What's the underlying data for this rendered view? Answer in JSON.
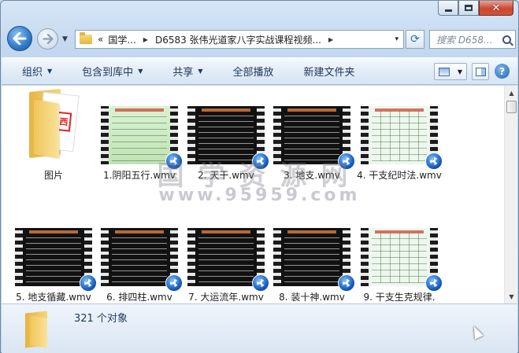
{
  "window": {
    "caption": {
      "minimize": "minimize",
      "maximize": "maximize",
      "close": "close"
    }
  },
  "nav": {
    "address": {
      "overflow": "«",
      "crumbs": [
        "国学...",
        "D6583 张伟光道家八字实战课程视频..."
      ],
      "dropdown": "▾"
    },
    "search_placeholder": "搜索 D658..."
  },
  "toolbar": {
    "organize": "组织",
    "include_library": "包含到库中",
    "share": "共享",
    "play_all": "全部播放",
    "new_folder": "新建文件夹"
  },
  "watermark": {
    "line1": "国学资源网",
    "line2": "www.95959.com"
  },
  "items": [
    {
      "label": "图片",
      "kind": "folder"
    },
    {
      "label": "1.阴阳五行.wmv",
      "kind": "video",
      "style": "green"
    },
    {
      "label": "2. 天干.wmv",
      "kind": "video",
      "style": "dark"
    },
    {
      "label": "3. 地支.wmv",
      "kind": "video",
      "style": "dark"
    },
    {
      "label": "4. 干支纪时法.wmv",
      "kind": "video",
      "style": "light"
    },
    {
      "label": "5. 地支循藏.wmv",
      "kind": "video",
      "style": "dark"
    },
    {
      "label": "6. 排四柱.wmv",
      "kind": "video",
      "style": "dark"
    },
    {
      "label": "7. 大运流年.wmv",
      "kind": "video",
      "style": "dark"
    },
    {
      "label": "8. 装十神.wmv",
      "kind": "video",
      "style": "dark"
    },
    {
      "label": "9. 干支生克规律.",
      "kind": "video",
      "style": "light"
    }
  ],
  "status": {
    "count": "321 个对象"
  },
  "colors": {
    "accent": "#1e395b",
    "content_bg": "#ffffff",
    "frame_bg": "#c9dcf0"
  }
}
